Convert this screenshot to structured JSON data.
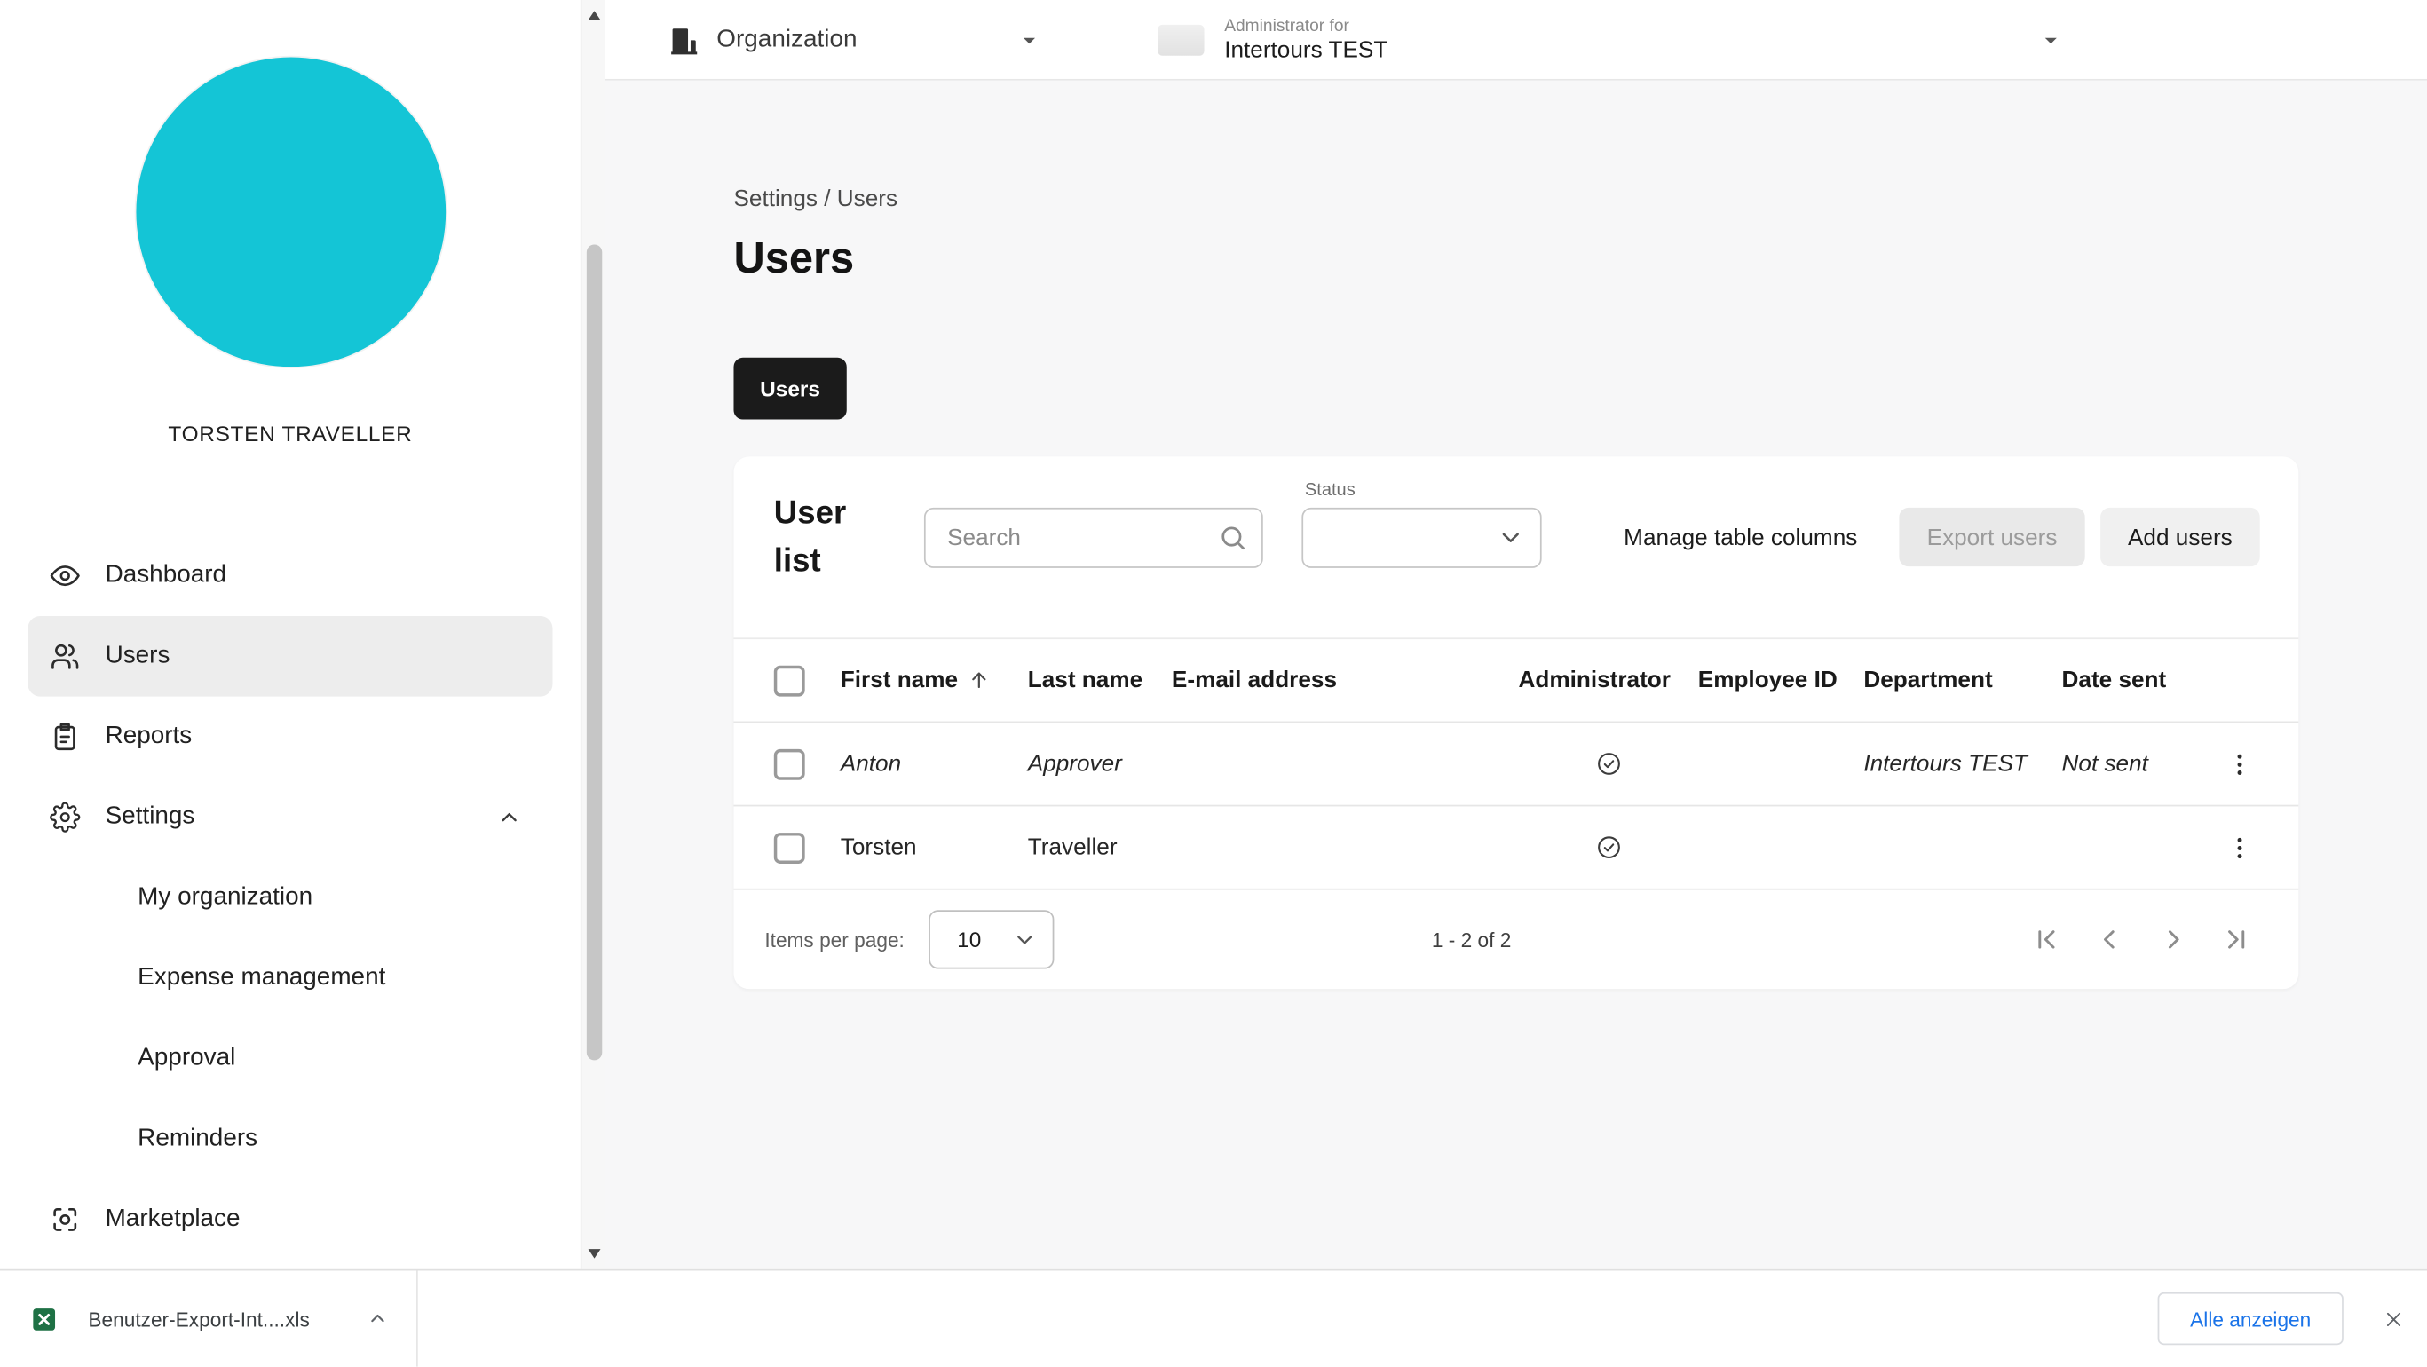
{
  "colors": {
    "avatar": "#14c5d6",
    "accent_blue": "#1a73e8"
  },
  "topbar": {
    "organization_label": "Organization",
    "admin_for_label": "Administrator for",
    "admin_org_name": "Intertours TEST"
  },
  "sidebar": {
    "profile_name": "TORSTEN TRAVELLER",
    "items": [
      {
        "label": "Dashboard"
      },
      {
        "label": "Users"
      },
      {
        "label": "Reports"
      },
      {
        "label": "Settings"
      },
      {
        "label": "My organization"
      },
      {
        "label": "Expense management"
      },
      {
        "label": "Approval"
      },
      {
        "label": "Reminders"
      },
      {
        "label": "Marketplace"
      }
    ]
  },
  "main": {
    "breadcrumb": "Settings / Users",
    "page_title": "Users",
    "tab_label": "Users",
    "card": {
      "title": "User list",
      "search_placeholder": "Search",
      "status_label": "Status",
      "manage_columns_label": "Manage table columns",
      "export_users_label": "Export users",
      "add_users_label": "Add users"
    },
    "table": {
      "columns": [
        "First name",
        "Last name",
        "E-mail address",
        "Administrator",
        "Employee ID",
        "Department",
        "Date sent"
      ],
      "rows": [
        {
          "first_name": "Anton",
          "last_name": "Approver",
          "email": "",
          "administrator": true,
          "employee_id": "",
          "department": "Intertours TEST",
          "date_sent": "Not sent"
        },
        {
          "first_name": "Torsten",
          "last_name": "Traveller",
          "email": "",
          "administrator": true,
          "employee_id": "",
          "department": "",
          "date_sent": ""
        }
      ]
    },
    "pagination": {
      "items_per_page_label": "Items per page:",
      "items_per_page_value": "10",
      "range_label": "1 - 2 of 2"
    }
  },
  "download_bar": {
    "file_name": "Benutzer-Export-Int....xls",
    "show_all_label": "Alle anzeigen"
  }
}
